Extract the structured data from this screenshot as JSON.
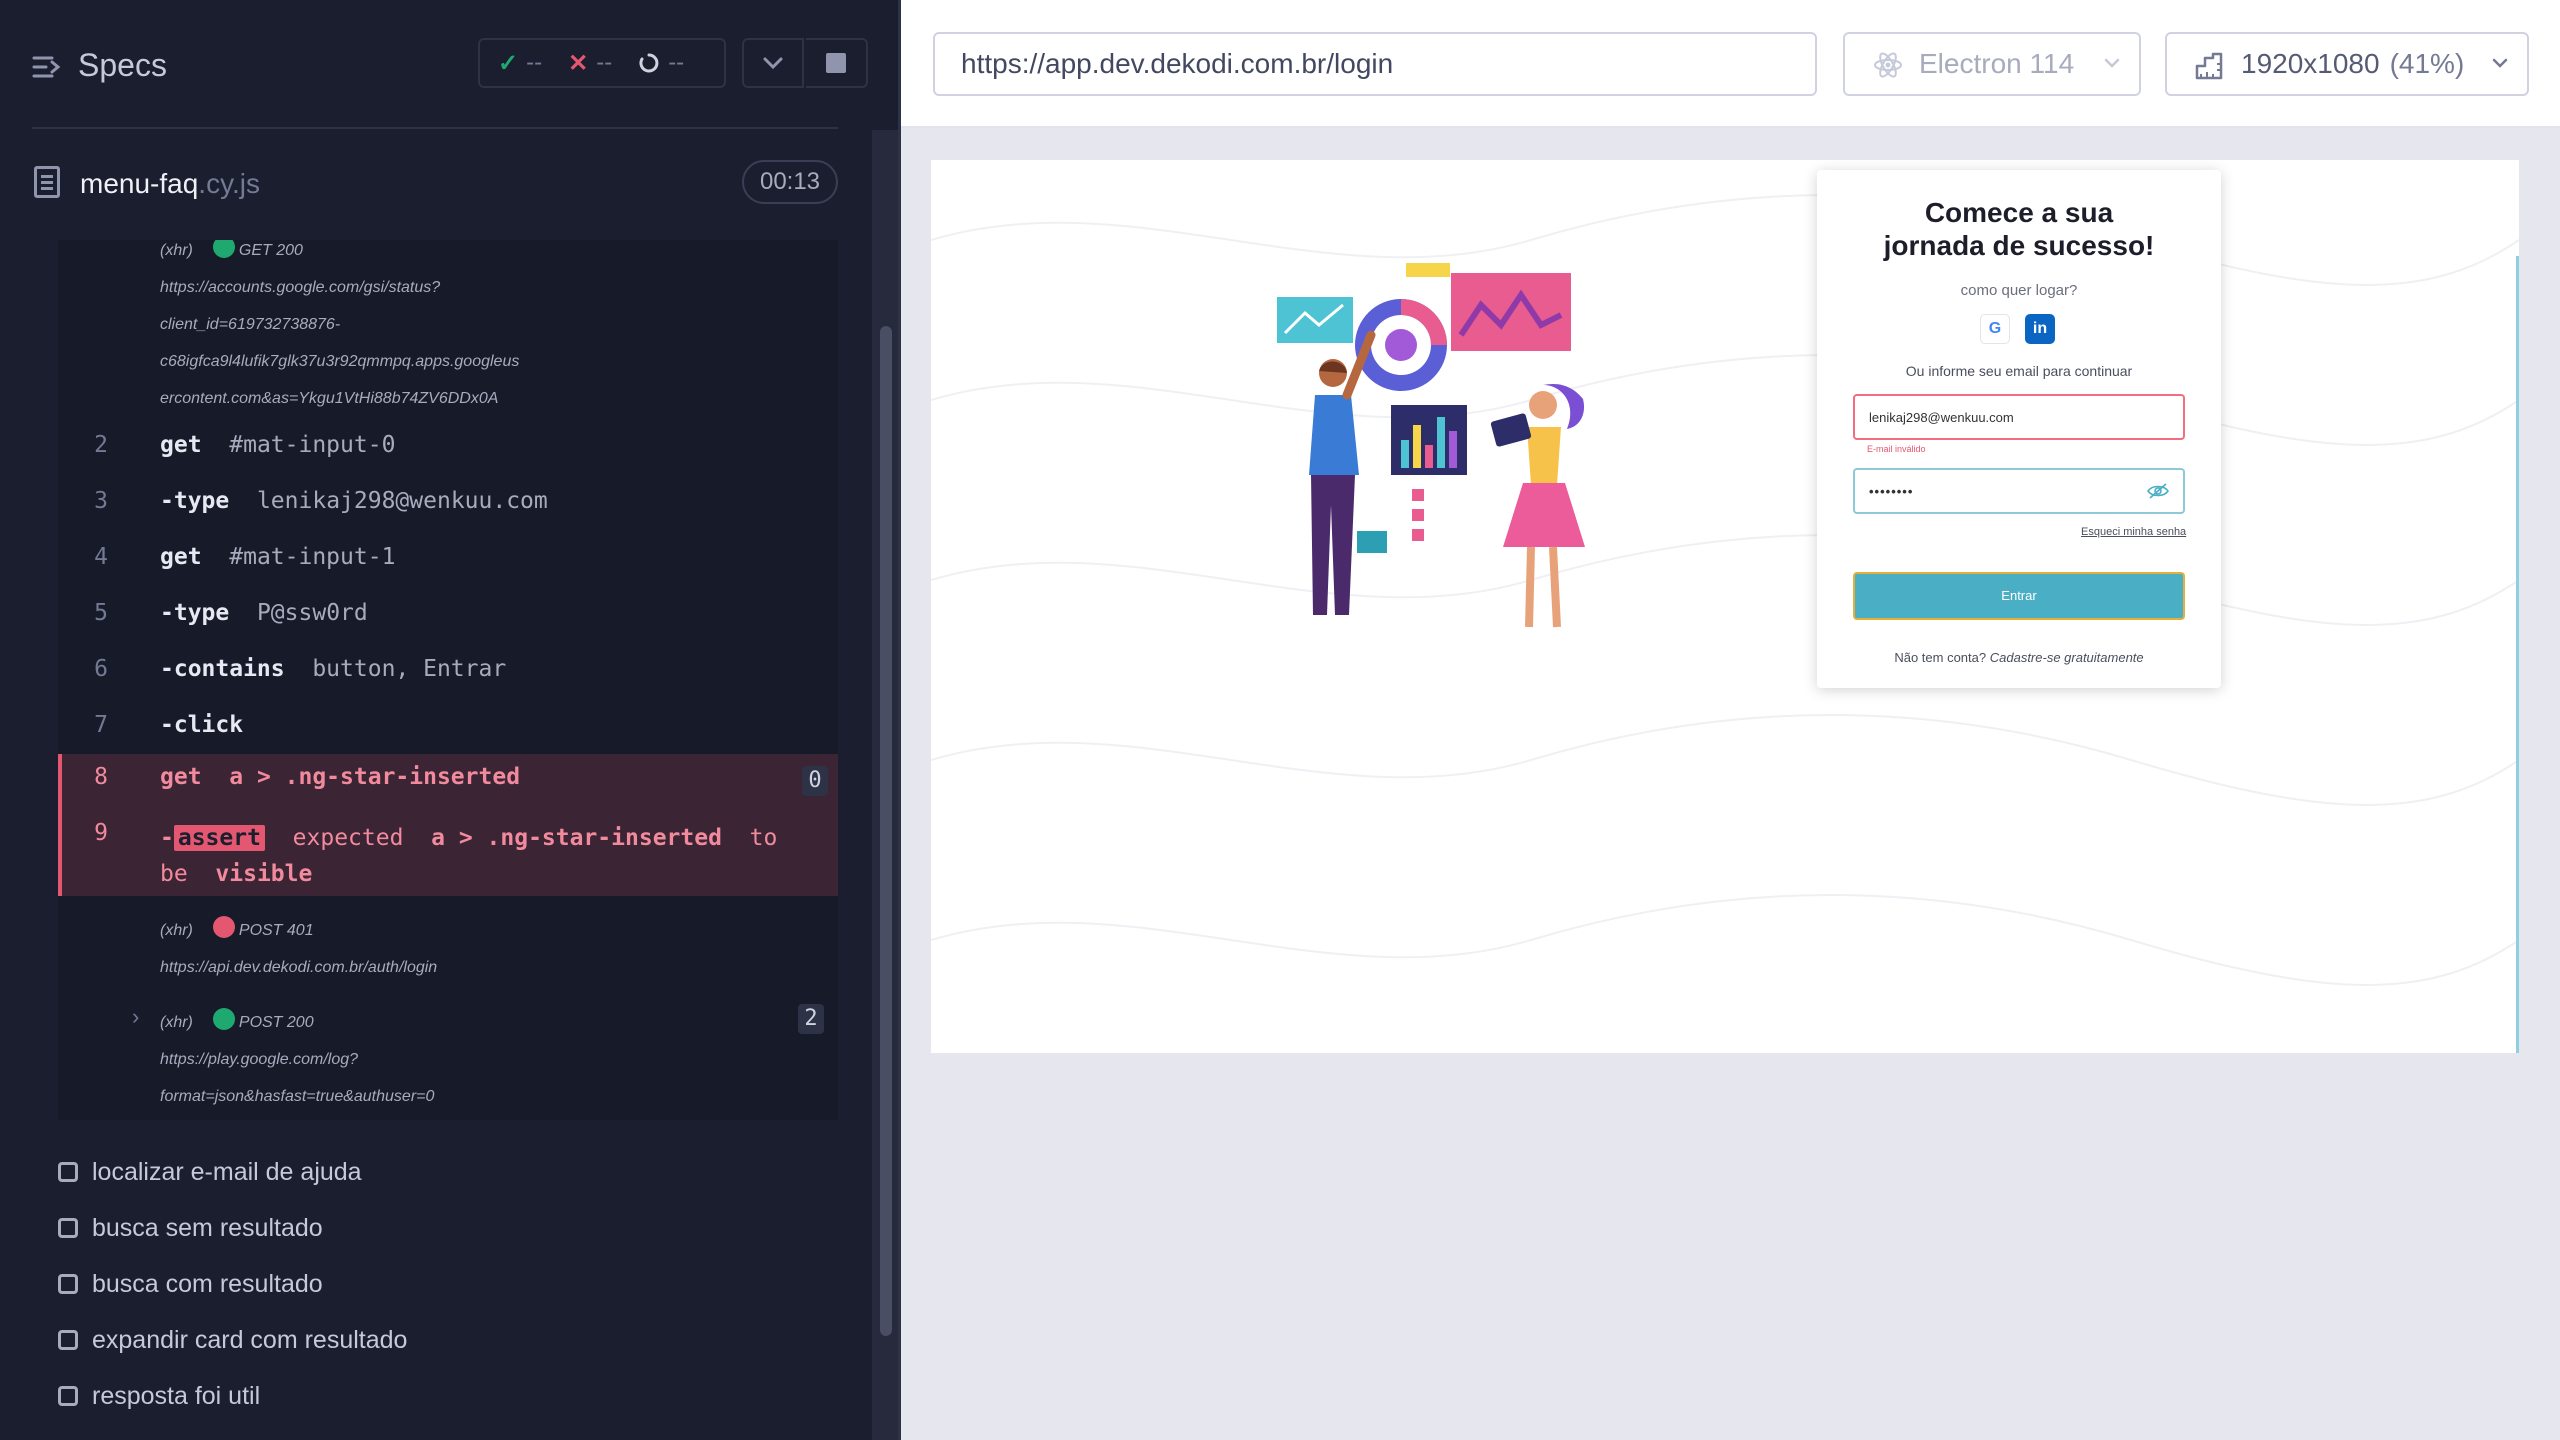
{
  "runner": {
    "header": {
      "title": "Specs",
      "passed": "--",
      "failed": "--",
      "pending": "--"
    },
    "spec": {
      "name": "menu-faq",
      "ext": ".cy.js",
      "duration": "00:13"
    },
    "log": {
      "xhr1": {
        "prefix": "(xhr)",
        "status": "GET 200",
        "url_lines": [
          "https://accounts.google.com/gsi/status?",
          "client_id=619732738876-",
          "c68igfca9l4lufik7glk37u3r92qmmpq.apps.googleus",
          "ercontent.com&as=Ykgu1VtHi88b74ZV6DDx0A"
        ]
      },
      "commands": [
        {
          "num": "2",
          "name": "get",
          "arg": "#mat-input-0"
        },
        {
          "num": "3",
          "name": "-type",
          "arg": "lenikaj298@wenkuu.com"
        },
        {
          "num": "4",
          "name": "get",
          "arg": "#mat-input-1"
        },
        {
          "num": "5",
          "name": "-type",
          "arg": "P@ssw0rd"
        },
        {
          "num": "6",
          "name": "-contains",
          "arg": "button, Entrar"
        },
        {
          "num": "7",
          "name": "-click",
          "arg": ""
        }
      ],
      "failed_get": {
        "num": "8",
        "name": "get",
        "arg": "a > .ng-star-inserted",
        "count": "0"
      },
      "failed_assert": {
        "num": "9",
        "dash": "-",
        "tag": "assert",
        "w1": "expected",
        "w2": "a > .ng-star-inserted",
        "w3": "to",
        "w4": "be",
        "w5": "visible"
      },
      "xhr2": {
        "prefix": "(xhr)",
        "status": "POST 401",
        "url": "https://api.dev.dekodi.com.br/auth/login"
      },
      "xhr3": {
        "prefix": "(xhr)",
        "status": "POST 200",
        "count": "2",
        "url_lines": [
          "https://play.google.com/log?",
          "format=json&hasfast=true&authuser=0"
        ]
      }
    },
    "tests": [
      "localizar e-mail de ajuda",
      "busca sem resultado",
      "busca com resultado",
      "expandir card com resultado",
      "resposta foi util"
    ]
  },
  "browser": {
    "url": "https://app.dev.dekodi.com.br/login",
    "name": "Electron 114",
    "viewport": "1920x1080",
    "scale": "(41%)"
  },
  "login": {
    "title_line1": "Comece a sua",
    "title_line2": "jornada de sucesso!",
    "subtitle": "como quer logar?",
    "email_hint": "Ou informe seu email para continuar",
    "email_value": "lenikaj298@wenkuu.com",
    "email_error": "E-mail inválido",
    "password_value": "••••••••",
    "forgot": "Esqueci minha senha",
    "submit": "Entrar",
    "footer_text": "Não tem conta?",
    "footer_link": "Cadastre-se gratuitamente"
  },
  "colors": {
    "pass": "#1fa971",
    "fail": "#e45770",
    "accent": "#4aafc4"
  }
}
